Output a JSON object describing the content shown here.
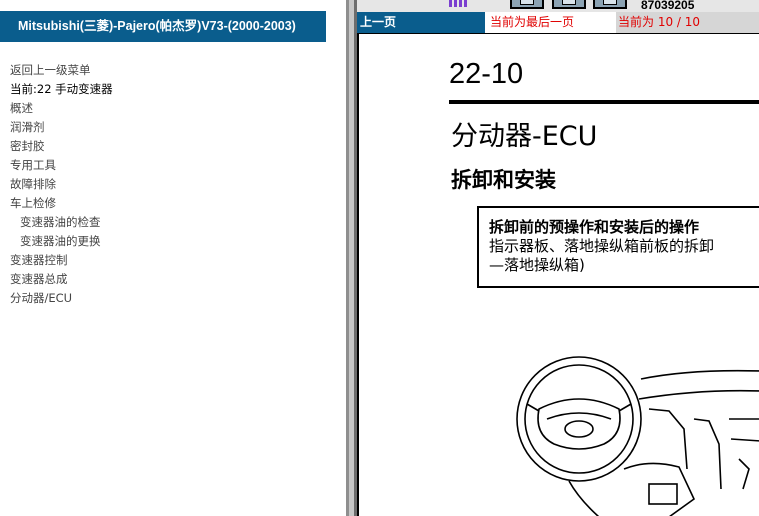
{
  "left_panel": {
    "title": "Mitsubishi(三菱)-Pajero(帕杰罗)V73-(2000-2003)",
    "menu": [
      {
        "label": "返回上一级菜单",
        "type": "link"
      },
      {
        "label": "当前:22 手动变速器",
        "type": "current"
      },
      {
        "label": "概述",
        "type": "link"
      },
      {
        "label": "润滑剂",
        "type": "link"
      },
      {
        "label": "密封胶",
        "type": "link"
      },
      {
        "label": "专用工具",
        "type": "link"
      },
      {
        "label": "故障排除",
        "type": "link"
      },
      {
        "label": "车上检修",
        "type": "link"
      },
      {
        "label": "变速器油的检查",
        "type": "sub"
      },
      {
        "label": "变速器油的更换",
        "type": "sub"
      },
      {
        "label": "变速器控制",
        "type": "link"
      },
      {
        "label": "变速器总成",
        "type": "link"
      },
      {
        "label": "分动器/ECU",
        "type": "link"
      }
    ]
  },
  "top_strip": {
    "code": "87039205"
  },
  "nav": {
    "prev_label": "上一页",
    "last_label": "当前为最后一页",
    "current_label": "当前为  10 / 10"
  },
  "document": {
    "page_number": "22-10",
    "title": "分动器-ECU",
    "subtitle": "拆卸和安装",
    "note_title": "拆卸前的预操作和安装后的操作",
    "note_line1": "指示器板、落地操纵箱前板的拆卸",
    "note_line2": "—落地操纵箱)"
  },
  "colors": {
    "title_bar_bg": "#0a5d8d",
    "nav_alert": "#e00000",
    "divider": "#c7c7c7"
  }
}
